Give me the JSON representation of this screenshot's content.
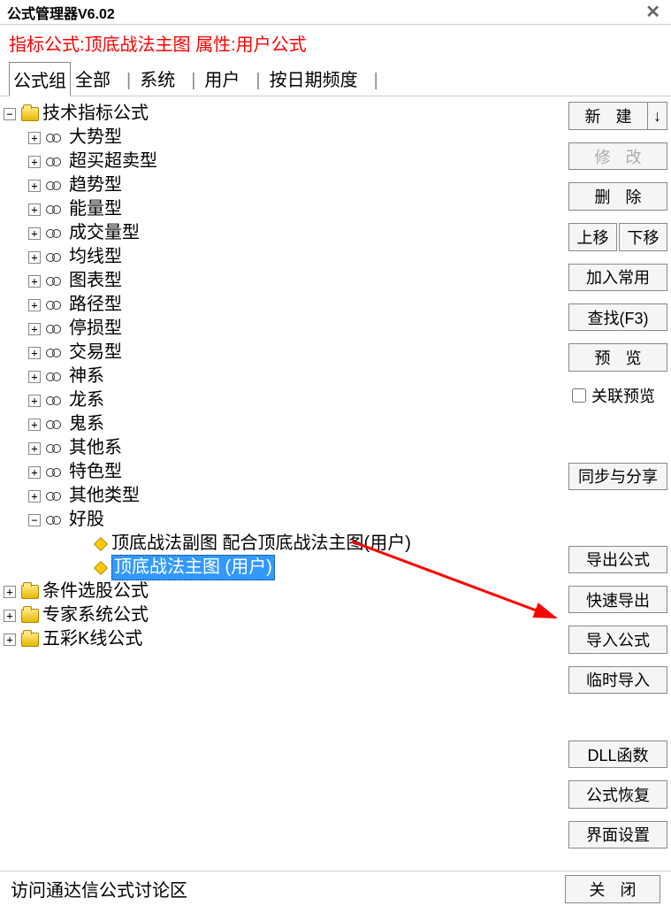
{
  "window": {
    "title": "公式管理器V6.02",
    "close": "✕"
  },
  "header": "指标公式:顶底战法主图 属性:用户公式",
  "tabs": [
    {
      "label": "公式组",
      "active": true
    },
    {
      "label": "全部"
    },
    {
      "label": "系统"
    },
    {
      "label": "用户"
    },
    {
      "label": "按日期频度"
    }
  ],
  "tree": {
    "root1": "技术指标公式",
    "subtypes": [
      "大势型",
      "超买超卖型",
      "趋势型",
      "能量型",
      "成交量型",
      "均线型",
      "图表型",
      "路径型",
      "停损型",
      "交易型",
      "神系",
      "龙系",
      "鬼系",
      "其他系",
      "特色型",
      "其他类型",
      "好股"
    ],
    "leaf1": "顶底战法副图   配合顶底战法主图(用户)",
    "leaf2": "顶底战法主图   (用户)",
    "root2": "条件选股公式",
    "root3": "专家系统公式",
    "root4": "五彩K线公式"
  },
  "buttons": {
    "new": "新 建",
    "modify": "修 改",
    "delete": "删 除",
    "up": "上移",
    "down": "下移",
    "addcommon": "加入常用",
    "find": "查找(F3)",
    "preview": "预 览",
    "linkpreview": "关联预览",
    "sync": "同步与分享",
    "export": "导出公式",
    "quickexport": "快速导出",
    "import": "导入公式",
    "tempimport": "临时导入",
    "dll": "DLL函数",
    "restore": "公式恢复",
    "uisetting": "界面设置",
    "close": "关 闭"
  },
  "footer": {
    "link": "访问通达信公式讨论区"
  }
}
